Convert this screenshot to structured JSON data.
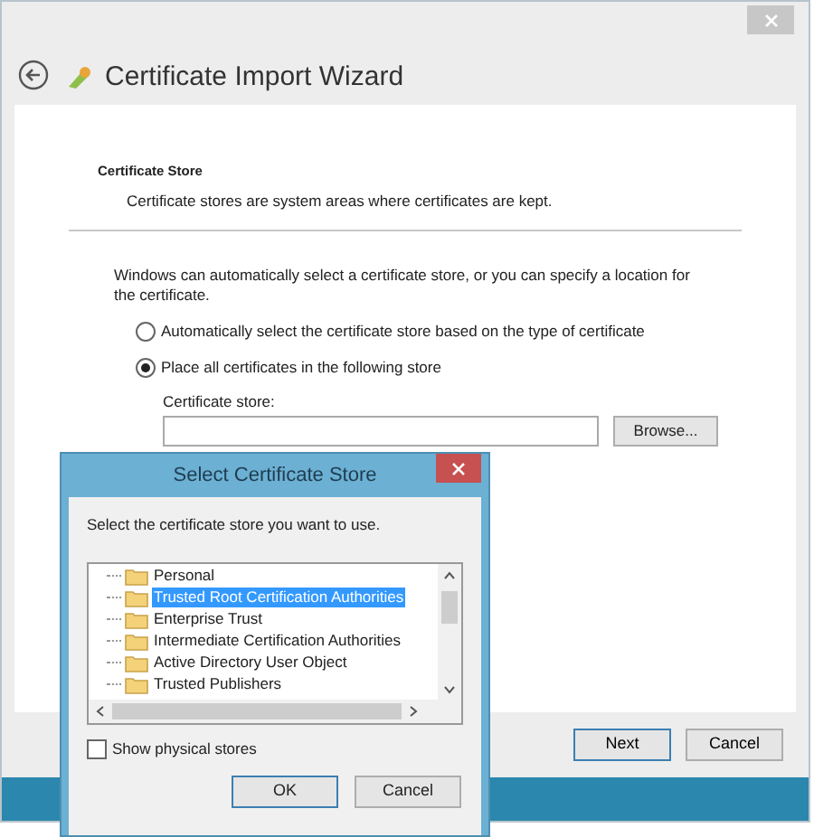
{
  "window": {
    "title": "Certificate Import Wizard"
  },
  "page": {
    "heading": "Certificate Store",
    "subheading": "Certificate stores are system areas where certificates are kept.",
    "description": "Windows can automatically select a certificate store, or you can specify a location for the certificate.",
    "options": [
      {
        "label": "Automatically select the certificate store based on the type of certificate",
        "selected": false
      },
      {
        "label": "Place all certificates in the following store",
        "selected": true
      }
    ],
    "store_label": "Certificate store:",
    "browse_button": "Browse..."
  },
  "buttons": [
    "Next",
    "Cancel"
  ],
  "dialog": {
    "title": "Select Certificate Store",
    "instruction": "Select the certificate store you want to use.",
    "stores": [
      {
        "label": "Personal",
        "selected": false
      },
      {
        "label": "Trusted Root Certification Authorities",
        "selected": true
      },
      {
        "label": "Enterprise Trust",
        "selected": false
      },
      {
        "label": "Intermediate Certification Authorities",
        "selected": false
      },
      {
        "label": "Active Directory User Object",
        "selected": false
      },
      {
        "label": "Trusted Publishers",
        "selected": false
      }
    ],
    "show_physical_stores": {
      "label": "Show physical stores",
      "checked": false
    },
    "buttons": [
      "OK",
      "Cancel"
    ]
  }
}
